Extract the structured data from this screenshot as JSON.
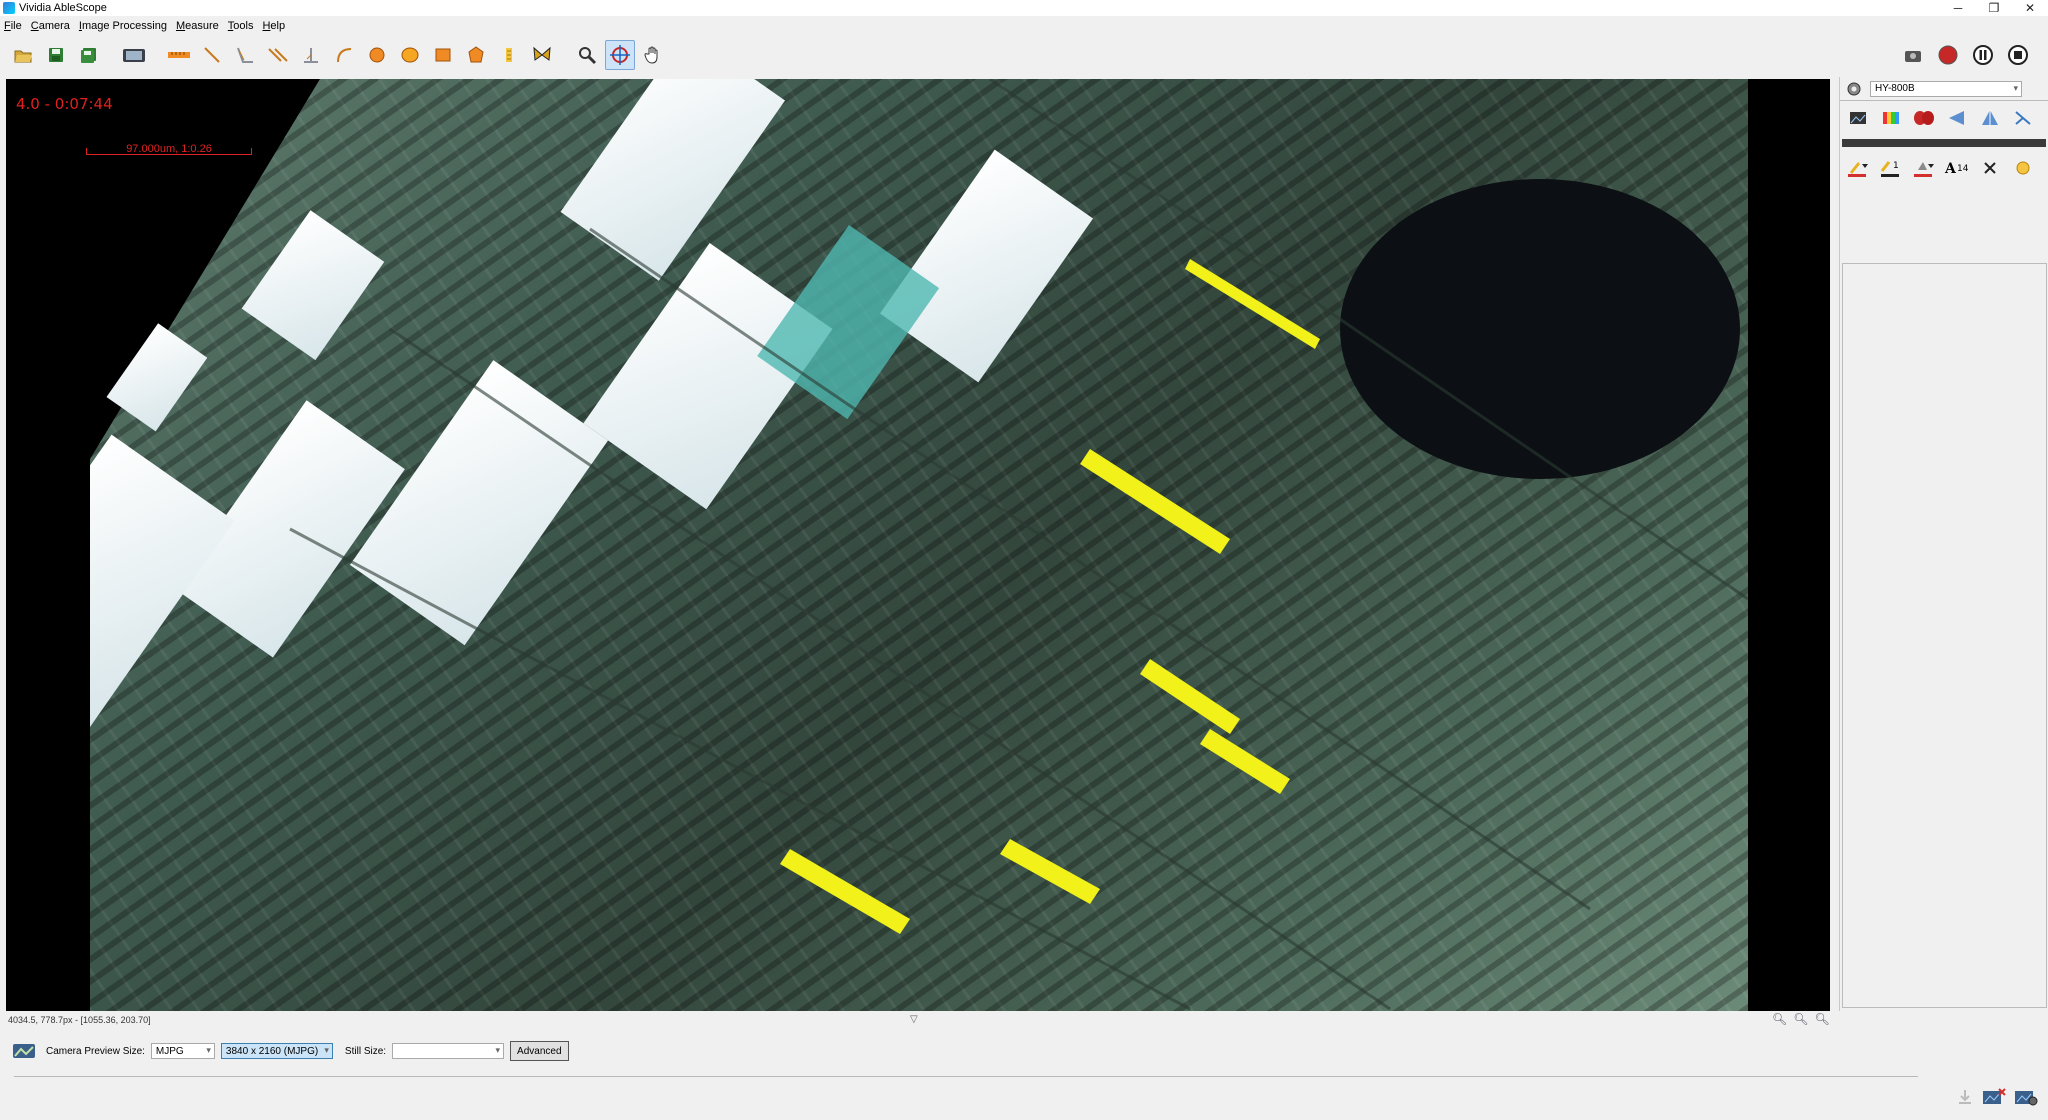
{
  "window": {
    "title": "Vividia AbleScope",
    "minimize": "─",
    "restore": "❐",
    "close": "✕"
  },
  "menu": [
    {
      "label": "File",
      "u": "F",
      "rest": "ile"
    },
    {
      "label": "Camera",
      "u": "C",
      "rest": "amera"
    },
    {
      "label": "Image Processing",
      "u": "I",
      "rest": "mage Processing"
    },
    {
      "label": "Measure",
      "u": "M",
      "rest": "easure"
    },
    {
      "label": "Tools",
      "u": "T",
      "rest": "ools"
    },
    {
      "label": "Help",
      "u": "H",
      "rest": "elp"
    }
  ],
  "toolbar": {
    "icons": [
      "open-icon",
      "save-icon",
      "save-all-icon",
      "snapshot-icon",
      "ruler-icon",
      "line-icon",
      "angle-icon",
      "parallel-icon",
      "perpendicular-icon",
      "arc-icon",
      "circle-icon",
      "ellipse-icon",
      "rectangle-icon",
      "polygon-icon",
      "counter-icon",
      "butterfly-icon",
      "zoom-icon",
      "crosshair-icon",
      "pan-icon"
    ],
    "active": "crosshair-icon",
    "right_icons": [
      "camera-settings-icon",
      "record-icon",
      "pause-icon",
      "stop-icon"
    ]
  },
  "overlay": {
    "timestamp": "4.0 - 0:07:44",
    "scalebar_label": "97.000um, 1:0.26"
  },
  "right_panel": {
    "camera_name": "HY-800B",
    "row1_icons": [
      "image-icon",
      "color-icon",
      "effects-icon",
      "flip-horizontal-icon",
      "flip-vertical-icon",
      "rotate-icon"
    ],
    "row2_icons": [
      "pen-color-icon",
      "line-width-icon",
      "fill-color-icon",
      "font-size-icon",
      "clear-icon",
      "brightness-icon"
    ],
    "line_width_label": "1",
    "font_size_label": "14"
  },
  "status": {
    "coords": "4034.5, 778.7px - [1055.36, 203.70]"
  },
  "bottom": {
    "preview_label": "Camera Preview Size:",
    "format_value": "MJPG",
    "resolution_value": "3840 x 2160 (MJPG)",
    "still_label": "Still Size:",
    "still_value": "",
    "advanced_label": "Advanced"
  },
  "colors": {
    "accent": "#e02020",
    "selection": "#cce4f7"
  }
}
